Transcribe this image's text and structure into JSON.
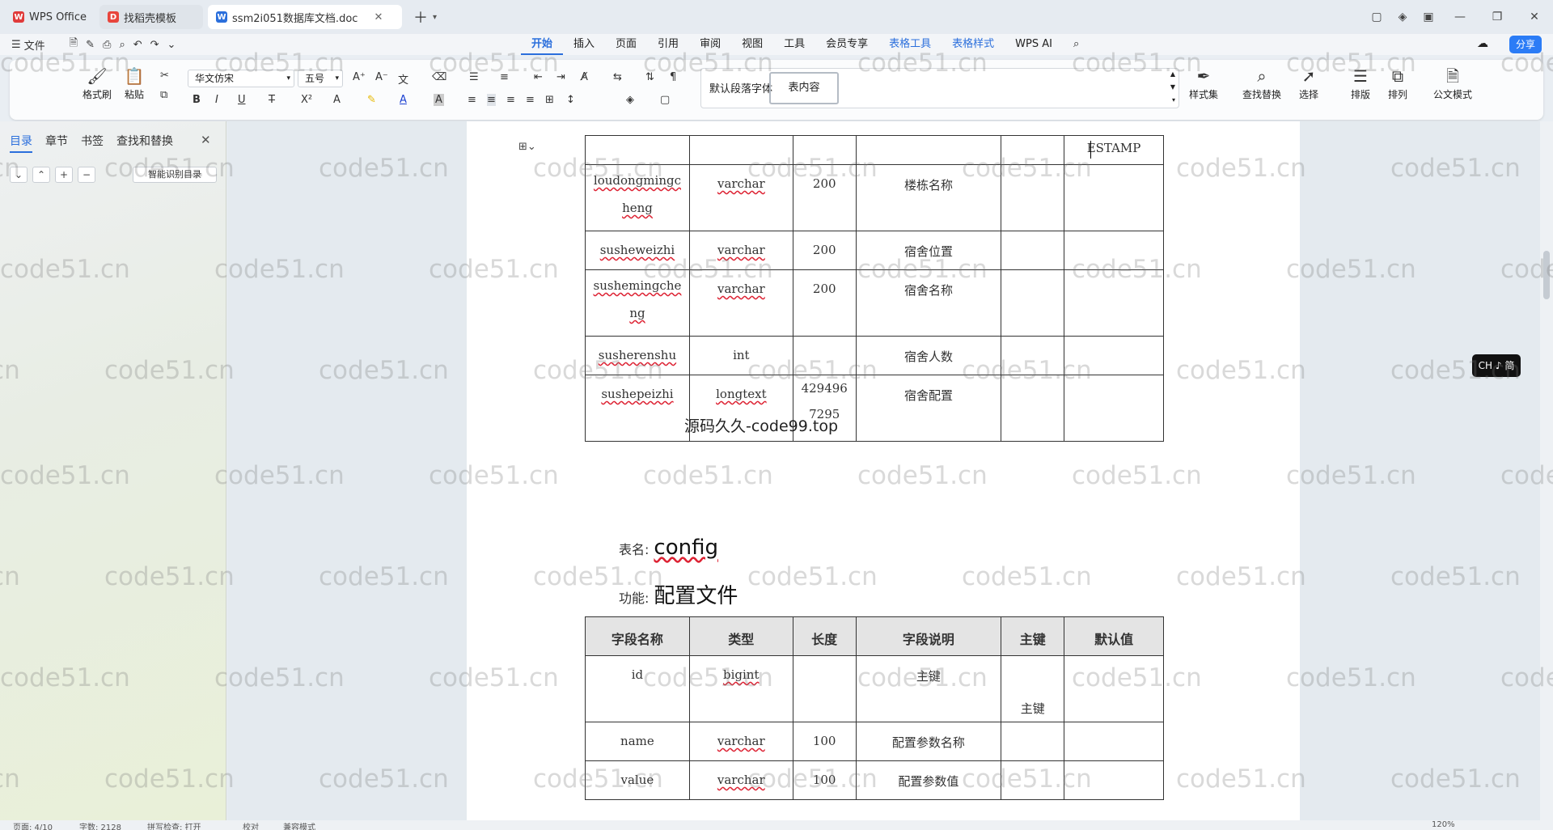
{
  "tabs": [
    {
      "label": "WPS Office",
      "icon": "wps-logo-icon"
    },
    {
      "label": "找稻壳模板",
      "icon": "docer-icon"
    },
    {
      "label": "ssm2i051数据库文档.doc",
      "icon": "word-doc-icon"
    }
  ],
  "menu": {
    "file": "文件",
    "tabs": [
      "开始",
      "插入",
      "页面",
      "引用",
      "审阅",
      "视图",
      "工具",
      "会员专享",
      "表格工具",
      "表格样式",
      "WPS AI"
    ],
    "share": "分享"
  },
  "ribbon": {
    "format_painter": "格式刷",
    "paste": "粘贴",
    "font_name": "华文仿宋",
    "font_size": "五号",
    "style_default": "默认段落字体",
    "style_current": "表内容",
    "style_set": "样式集",
    "find_replace": "查找替换",
    "select": "选择",
    "layout": "排版",
    "arrange": "排列",
    "official_mode": "公文模式"
  },
  "sidebar": {
    "tabs": [
      "目录",
      "章节",
      "书签",
      "查找和替换"
    ],
    "smart_toc": "智能识别目录"
  },
  "table1": {
    "top_row_last": "ESTAMP",
    "rows": [
      {
        "name": "loudongmingc",
        "name2": "heng",
        "type": "varchar",
        "len": "200",
        "desc": "楼栋名称"
      },
      {
        "name": "susheweizhi",
        "type": "varchar",
        "len": "200",
        "desc": "宿舍位置"
      },
      {
        "name": "sushemingche",
        "name2": "ng",
        "type": "varchar",
        "len": "200",
        "desc": "宿舍名称"
      },
      {
        "name": "susherenshu",
        "type": "int",
        "len": "",
        "desc": "宿舍人数"
      },
      {
        "name": "sushepeizhi",
        "type": "longtext",
        "len": "429496",
        "len2": "7295",
        "desc": "宿舍配置"
      }
    ]
  },
  "overlay_text": "源码久久-code99.top",
  "section": {
    "table_label": "表名:",
    "table_name": "config",
    "func_label": "功能:",
    "func_name": "配置文件"
  },
  "table2": {
    "headers": [
      "字段名称",
      "类型",
      "长度",
      "字段说明",
      "主键",
      "默认值"
    ],
    "rows": [
      {
        "name": "id",
        "type": "bigint",
        "len": "",
        "desc": "主键",
        "pk": "主键",
        "def": ""
      },
      {
        "name": "name",
        "type": "varchar",
        "len": "100",
        "desc": "配置参数名称",
        "pk": "",
        "def": ""
      },
      {
        "name": "value",
        "type": "varchar",
        "len": "100",
        "desc": "配置参数值",
        "pk": "",
        "def": ""
      }
    ]
  },
  "watermark": "code51.cn",
  "ime": "CH ♪ 简",
  "status": {
    "page": "页面: 4/10",
    "words": "字数: 2128",
    "spell": "拼写检查: 打开",
    "proof": "校对",
    "compat": "兼容模式",
    "zoom": "120%"
  }
}
